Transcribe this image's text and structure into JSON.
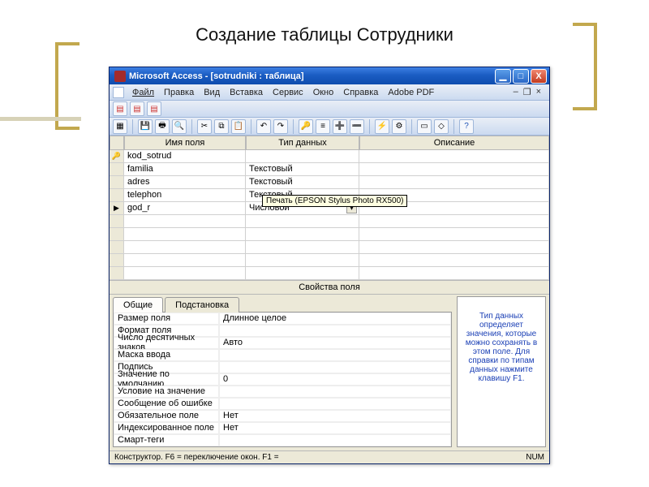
{
  "page_title": "Создание таблицы Сотрудники",
  "window": {
    "title": "Microsoft Access  -  [sotrudniki : таблица]",
    "controls": {
      "min": "▁",
      "max": "□",
      "close": "X"
    },
    "doc_controls": {
      "min": "–",
      "restore": "❐",
      "close": "×"
    }
  },
  "menu": {
    "file": "Файл",
    "edit": "Правка",
    "view": "Вид",
    "insert": "Вставка",
    "tools": "Сервис",
    "window": "Окно",
    "help": "Справка",
    "adobe": "Adobe PDF"
  },
  "tooltip": "Печать (EPSON Stylus Photo RX500)",
  "grid": {
    "headers": {
      "name": "Имя поля",
      "type": "Тип данных",
      "desc": "Описание"
    },
    "rows": [
      {
        "marker": "key",
        "name": "kod_sotrud",
        "type": ""
      },
      {
        "marker": "",
        "name": "familia",
        "type": "Текстовый"
      },
      {
        "marker": "",
        "name": "adres",
        "type": "Текстовый"
      },
      {
        "marker": "",
        "name": "telephon",
        "type": "Текстовый"
      },
      {
        "marker": "cur",
        "name": "god_r",
        "type": "Числовой",
        "dropdown": true
      },
      {
        "marker": "",
        "name": "",
        "type": ""
      },
      {
        "marker": "",
        "name": "",
        "type": ""
      },
      {
        "marker": "",
        "name": "",
        "type": ""
      },
      {
        "marker": "",
        "name": "",
        "type": ""
      },
      {
        "marker": "",
        "name": "",
        "type": ""
      }
    ]
  },
  "properties": {
    "section_title": "Свойства поля",
    "tabs": {
      "general": "Общие",
      "lookup": "Подстановка"
    },
    "rows": [
      {
        "label": "Размер поля",
        "value": "Длинное целое"
      },
      {
        "label": "Формат поля",
        "value": ""
      },
      {
        "label": "Число десятичных знаков",
        "value": "Авто"
      },
      {
        "label": "Маска ввода",
        "value": ""
      },
      {
        "label": "Подпись",
        "value": ""
      },
      {
        "label": "Значение по умолчанию",
        "value": "0"
      },
      {
        "label": "Условие на значение",
        "value": ""
      },
      {
        "label": "Сообщение об ошибке",
        "value": ""
      },
      {
        "label": "Обязательное поле",
        "value": "Нет"
      },
      {
        "label": "Индексированное поле",
        "value": "Нет"
      },
      {
        "label": "Смарт-теги",
        "value": ""
      }
    ],
    "help": "Тип данных определяет значения, которые можно сохранять в этом поле.  Для справки по типам данных нажмите клавишу F1."
  },
  "statusbar": {
    "left": "Конструктор.  F6 = переключение окон.  F1 =",
    "num": "NUM"
  }
}
